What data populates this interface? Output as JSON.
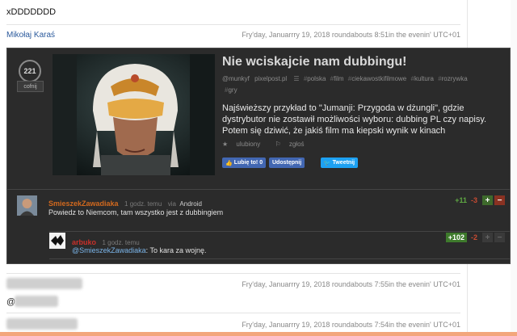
{
  "post": {
    "text": "xDDDDDDD",
    "author": "Mikołaj Karaś",
    "date": "Fry'day, Januarrry 19, 2018 roundabouts 8:51in the evenin' UTC+01"
  },
  "embed": {
    "votes": "221",
    "undo_label": "cofnij",
    "title": "Nie wciskajcie nam dubbingu!",
    "author": "@munkyf",
    "source": "pixelpost.pl",
    "tags": [
      "polska",
      "film",
      "ciekawostkifilmowe",
      "kultura",
      "rozrywka",
      "gry"
    ],
    "description": "Najświeższy przykład to \"Jumanji: Przygoda w dżungli\", gdzie dystrybutor nie zostawił możliwości wyboru: dubbing PL czy napisy. Potem się dziwić, że jakiś film ma kiepski wynik w kinach",
    "favorites_label": "ulubiony",
    "report_label": "zgłoś",
    "fb_like_label": "Lubię to! 0",
    "fb_share_label": "Udostępnij",
    "tweet_label": "Tweetnij"
  },
  "comments": [
    {
      "user": "SmieszekZawadiaka",
      "time": "1 godz. temu",
      "via": "via",
      "platform": "Android",
      "text": "Powiedz to Niemcom, tam wszystko jest z dubbingiem",
      "plus": "+11",
      "minus": "-3"
    },
    {
      "user": "arbuko",
      "time": "1 godz. temu",
      "mention": "@SmieszekZawadiaka",
      "text": ": To kara za wojnę.",
      "plus": "+102",
      "minus": "-2"
    }
  ],
  "entries": [
    {
      "date": "Fry'day, Januarrry 19, 2018 roundabouts 7:55in the evenin' UTC+01",
      "text": "@"
    },
    {
      "date": "Fry'day, Januarrry 19, 2018 roundabouts 7:54in the evenin' UTC+01"
    }
  ]
}
